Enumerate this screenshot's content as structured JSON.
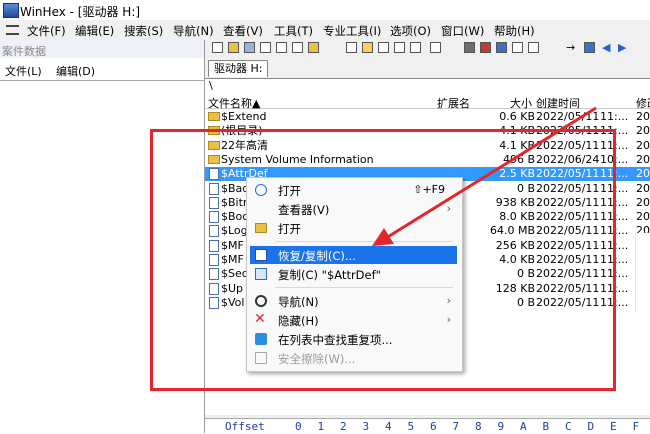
{
  "window": {
    "title": "WinHex - [驱动器 H:]"
  },
  "menubar": {
    "items": [
      "文件(F)",
      "编辑(E)",
      "搜索(S)",
      "导航(N)",
      "查看(V)",
      "工具(T)",
      "专业工具(I)",
      "选项(O)",
      "窗口(W)",
      "帮助(H)"
    ]
  },
  "left_panel": {
    "caption": "案件数据",
    "menu": [
      "文件(L)",
      "编辑(D)"
    ]
  },
  "tabs": {
    "active": "驱动器 H:"
  },
  "path": "\\",
  "table": {
    "columns": [
      "文件名称▲",
      "扩展名",
      "大小",
      "创建时间",
      "修改"
    ],
    "rows": [
      {
        "name": "$Extend",
        "size": "0.6 KB",
        "created": "2022/05/11",
        "time": "11:...",
        "mod": "20",
        "type": "folder",
        "selected": false
      },
      {
        "name": "(根目录)",
        "size": "4.1 KB",
        "created": "2022/05/11",
        "time": "11:...",
        "mod": "20",
        "type": "folder",
        "selected": false
      },
      {
        "name": "22年高清",
        "size": "4.1 KB",
        "created": "2022/05/11",
        "time": "11:...",
        "mod": "20",
        "type": "folder",
        "selected": false
      },
      {
        "name": "System Volume Information",
        "size": "496 B",
        "created": "2022/06/24",
        "time": "10:...",
        "mod": "20",
        "type": "folder",
        "selected": false
      },
      {
        "name": "$AttrDef",
        "size": "2.5 KB",
        "created": "2022/05/11",
        "time": "11:...",
        "mod": "20",
        "type": "file",
        "selected": true
      },
      {
        "name": "$Bad",
        "size": "0 B",
        "created": "2022/05/11",
        "time": "11:...",
        "mod": "20",
        "type": "file",
        "selected": false
      },
      {
        "name": "$Bitr",
        "size": "938 KB",
        "created": "2022/05/11",
        "time": "11:...",
        "mod": "20",
        "type": "file",
        "selected": false
      },
      {
        "name": "$Boc",
        "size": "8.0 KB",
        "created": "2022/05/11",
        "time": "11:...",
        "mod": "20",
        "type": "file",
        "selected": false
      },
      {
        "name": "$Log",
        "size": "64.0 MB",
        "created": "2022/05/11",
        "time": "11:...",
        "mod": "20",
        "type": "file",
        "selected": false
      },
      {
        "name": "$MF",
        "size": "256 KB",
        "created": "2022/05/11",
        "time": "11:...",
        "mod": "20",
        "type": "file",
        "selected": false
      },
      {
        "name": "$MF",
        "size": "4.0 KB",
        "created": "2022/05/11",
        "time": "11:...",
        "mod": "20",
        "type": "file",
        "selected": false
      },
      {
        "name": "$Sec",
        "size": "0 B",
        "created": "2022/05/11",
        "time": "11:...",
        "mod": "20",
        "type": "file",
        "selected": false
      },
      {
        "name": "$Up",
        "size": "128 KB",
        "created": "2022/05/11",
        "time": "11:...",
        "mod": "20",
        "type": "file",
        "selected": false
      },
      {
        "name": "$Vol",
        "size": "0 B",
        "created": "2022/05/11",
        "time": "11:...",
        "mod": "20",
        "type": "file",
        "selected": false
      }
    ]
  },
  "context_menu": {
    "open1": "打开",
    "open1_key": "⇧+F9",
    "viewer": "查看器(V)",
    "open2": "打开",
    "recover": "恢复/复制(C)...",
    "copy": "复制(C) \"$AttrDef\"",
    "navigate": "导航(N)",
    "hide": "隐藏(H)",
    "find_dup": "在列表中查找重复项...",
    "secure_erase": "安全擦除(W)..."
  },
  "hex_header": [
    "Offset",
    "0",
    "1",
    "2",
    "3",
    "4",
    "5",
    "6",
    "7",
    "8",
    "9",
    "A",
    "B",
    "C",
    "D",
    "E",
    "F"
  ],
  "colors": {
    "selection": "#3399ff",
    "menu_highlight": "#1a73e8",
    "annotation": "#e2262b"
  }
}
